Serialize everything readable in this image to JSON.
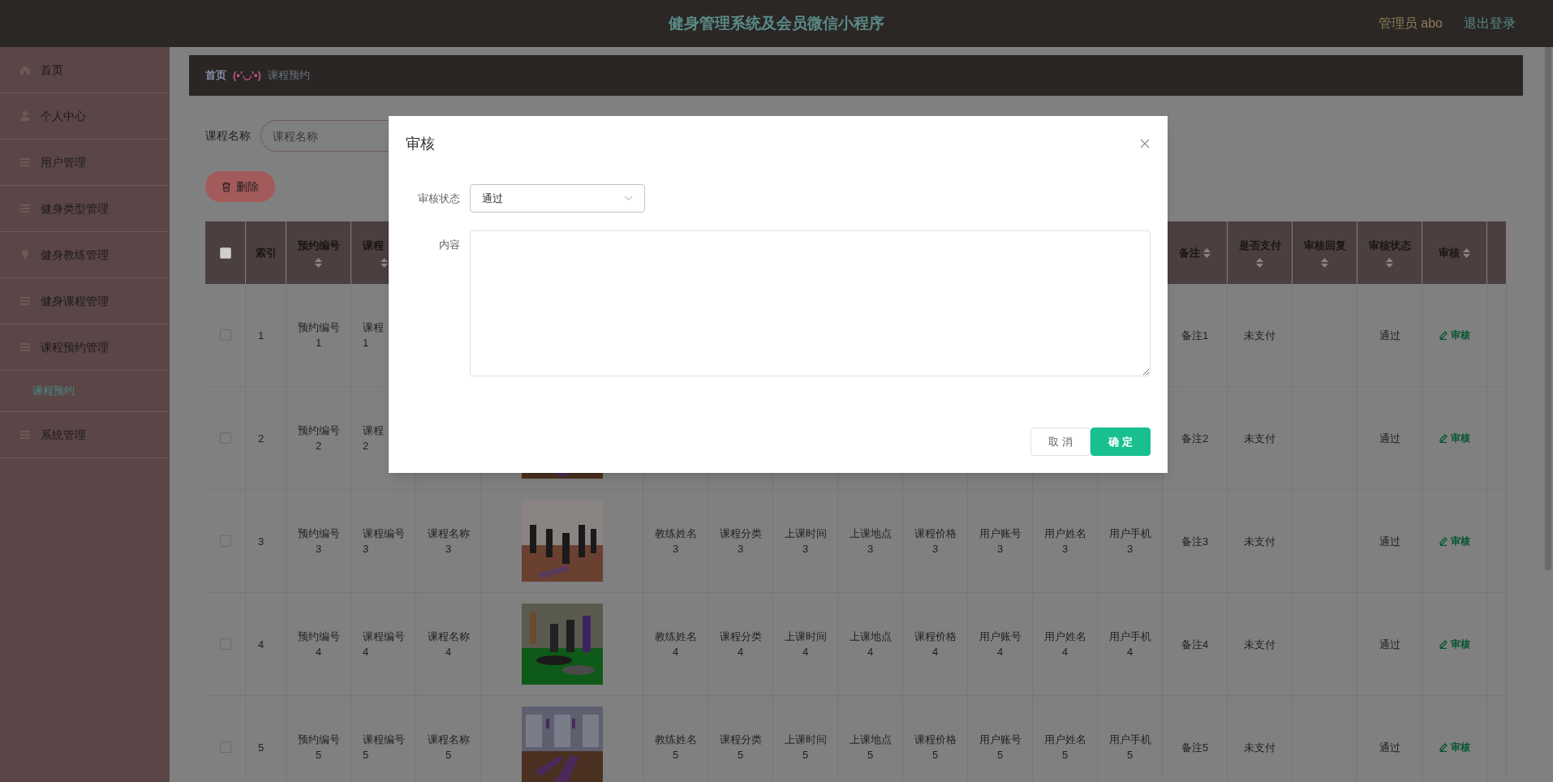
{
  "header": {
    "title": "健身管理系统及会员微信小程序",
    "user": "管理员 abo",
    "logout": "退出登录"
  },
  "sidebar": {
    "items": [
      {
        "label": "首页",
        "selected": false
      },
      {
        "label": "个人中心",
        "selected": false
      },
      {
        "label": "用户管理",
        "selected": false
      },
      {
        "label": "健身类型管理",
        "selected": false
      },
      {
        "label": "健身教练管理",
        "selected": false
      },
      {
        "label": "健身课程管理",
        "selected": false
      },
      {
        "label": "课程预约管理",
        "selected": false,
        "children": [
          {
            "label": "课程预约",
            "selected": true
          }
        ]
      },
      {
        "label": "系统管理",
        "selected": false
      }
    ]
  },
  "breadcrumb": {
    "home": "首页",
    "separator": "(•'◡'•)",
    "current": "课程预约"
  },
  "search": {
    "label": "课程名称",
    "placeholder": "课程名称"
  },
  "delete_button": "删除",
  "table": {
    "columns": [
      {
        "kind": "checkbox",
        "checked": false
      },
      {
        "label": "索引",
        "sortable": false
      },
      {
        "label": "预约编号",
        "sortable": true
      },
      {
        "label": "课程",
        "sortable": true
      },
      null,
      null,
      null,
      null,
      null,
      null,
      null,
      null,
      null,
      null,
      {
        "label": "备注",
        "sortable": true
      },
      {
        "label": "是否支付",
        "sortable": true
      },
      {
        "label": "审核回复",
        "sortable": true
      },
      {
        "label": "审核状态",
        "sortable": true
      },
      {
        "label": "审核",
        "sortable": true
      },
      null
    ],
    "rows": [
      {
        "cells": [
          {
            "kind": "checkbox",
            "checked": false
          },
          "1",
          "预约编号\n1",
          "课程\n1",
          null,
          null,
          null,
          null,
          null,
          null,
          null,
          null,
          null,
          null,
          "备注1",
          "未支付",
          null,
          "通过",
          {
            "kind": "action",
            "label": "审核"
          },
          null
        ]
      },
      {
        "cells": [
          {
            "kind": "checkbox",
            "checked": false
          },
          "2",
          "预约编号\n2",
          "课程\n2",
          null,
          {
            "kind": "picture"
          },
          null,
          null,
          null,
          null,
          null,
          null,
          null,
          null,
          "备注2",
          "未支付",
          null,
          "通过",
          {
            "kind": "action",
            "label": "审核"
          },
          null
        ]
      },
      {
        "cells": [
          {
            "kind": "checkbox",
            "checked": false
          },
          "3",
          "预约编号\n3",
          "课程编号\n3",
          "课程名称\n3",
          {
            "kind": "picture"
          },
          "教练姓名\n3",
          "课程分类\n3",
          "上课时间\n3",
          "上课地点\n3",
          "课程价格\n3",
          "用户账号\n3",
          "用户姓名\n3",
          "用户手机\n3",
          "备注3",
          "未支付",
          null,
          "通过",
          {
            "kind": "action",
            "label": "审核"
          },
          null
        ]
      },
      {
        "cells": [
          {
            "kind": "checkbox",
            "checked": false
          },
          "4",
          "预约编号\n4",
          "课程编号\n4",
          "课程名称\n4",
          {
            "kind": "picture"
          },
          "教练姓名\n4",
          "课程分类\n4",
          "上课时间\n4",
          "上课地点\n4",
          "课程价格\n4",
          "用户账号\n4",
          "用户姓名\n4",
          "用户手机\n4",
          "备注4",
          "未支付",
          null,
          "通过",
          {
            "kind": "action",
            "label": "审核"
          },
          null
        ]
      },
      {
        "cells": [
          {
            "kind": "checkbox",
            "checked": false
          },
          "5",
          "预约编号\n5",
          "课程编号\n5",
          "课程名称\n5",
          {
            "kind": "picture"
          },
          "教练姓名\n5",
          "课程分类\n5",
          "上课时间\n5",
          "上课地点\n5",
          "课程价格\n5",
          "用户账号\n5",
          "用户姓名\n5",
          "用户手机\n5",
          "备注5",
          "未支付",
          null,
          "通过",
          {
            "kind": "action",
            "label": "审核"
          },
          null
        ]
      }
    ]
  },
  "dialog": {
    "title": "审核",
    "fields": [
      {
        "kind": "select",
        "label": "审核状态",
        "value": "通过"
      },
      {
        "kind": "textarea",
        "label": "内容"
      }
    ],
    "buttons": [
      {
        "label": "取 消",
        "kind": "default"
      },
      {
        "label": "确 定",
        "kind": "primary"
      }
    ]
  }
}
